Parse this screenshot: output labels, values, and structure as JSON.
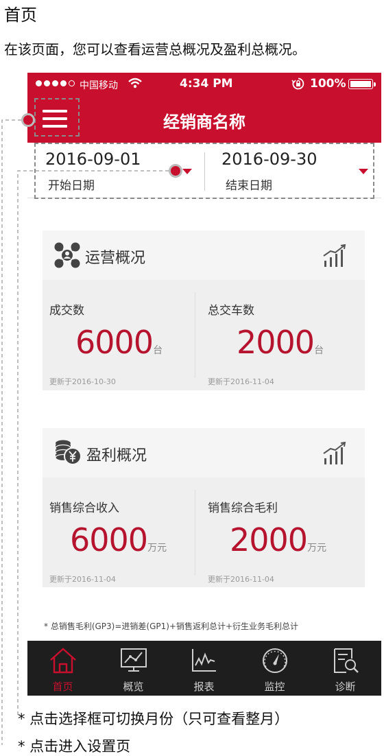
{
  "page": {
    "heading": "首页",
    "description": "在该页面，您可以查看运营总概况及盈利总概况。"
  },
  "status_bar": {
    "carrier": "中国移动",
    "time": "4:34 PM",
    "battery": "100%",
    "signal_icon": "signal-dots-icon",
    "wifi_icon": "wifi-icon",
    "lock_icon": "rotation-lock-icon"
  },
  "nav": {
    "title": "经销商名称",
    "menu_icon": "hamburger-menu-icon"
  },
  "date_filter": {
    "start_value": "2016-09-01",
    "start_label": "开始日期",
    "end_value": "2016-09-30",
    "end_label": "结束日期"
  },
  "operations": {
    "title": "运营概况",
    "icon": "network-people-icon",
    "trend_icon": "bar-trend-icon",
    "metrics": [
      {
        "label": "成交数",
        "value": "6000",
        "unit": "台",
        "updated": "更新于2016-10-30"
      },
      {
        "label": "总交车数",
        "value": "2000",
        "unit": "台",
        "updated": "更新于2016-11-04"
      }
    ]
  },
  "profit": {
    "title": "盈利概况",
    "icon": "yen-coins-icon",
    "trend_icon": "bar-trend-icon",
    "metrics": [
      {
        "label": "销售综合收入",
        "value": "6000",
        "unit": "万元",
        "updated": "更新于2016-11-04"
      },
      {
        "label": "销售综合毛利",
        "value": "2000",
        "unit": "万元",
        "updated": "更新于2016-11-04"
      }
    ]
  },
  "footnote": "* 总销售毛利(GP3)=进销差(GP1)+销售返利总计+衍生业务毛利总计",
  "tabbar": {
    "items": [
      {
        "label": "首页",
        "icon": "home-icon",
        "active": true
      },
      {
        "label": "概览",
        "icon": "overview-chart-icon",
        "active": false
      },
      {
        "label": "报表",
        "icon": "report-line-icon",
        "active": false
      },
      {
        "label": "监控",
        "icon": "gauge-icon",
        "active": false
      },
      {
        "label": "诊断",
        "icon": "diagnose-search-icon",
        "active": false
      }
    ]
  },
  "annotations": {
    "date_hint": "*  点击选择框可切换月份（只可查看整月）",
    "menu_hint": "*  点击进入设置页"
  },
  "colors": {
    "brand_red": "#c8102e",
    "value_red": "#b5132e",
    "tabbar_bg": "#1e1e1e",
    "card_bg": "#efefef"
  }
}
